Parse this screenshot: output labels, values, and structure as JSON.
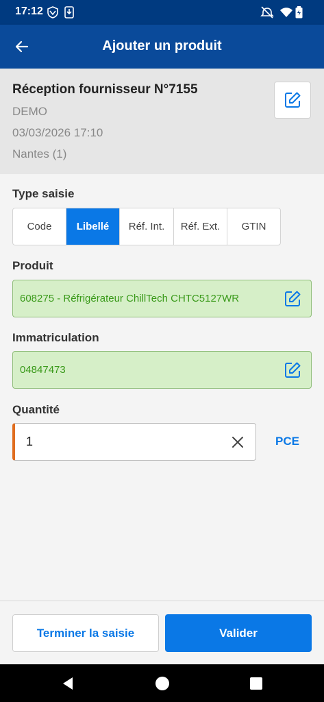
{
  "status_bar": {
    "time": "17:12"
  },
  "app_bar": {
    "title": "Ajouter un produit"
  },
  "document": {
    "title": "Réception fournisseur N°7155",
    "company": "DEMO",
    "datetime": "03/03/2026 17:10",
    "location": "Nantes (1)"
  },
  "type_saisie": {
    "label": "Type saisie",
    "options": [
      "Code",
      "Libellé",
      "Réf. Int.",
      "Réf. Ext.",
      "GTIN"
    ],
    "selected": "Libellé"
  },
  "produit": {
    "label": "Produit",
    "value": "608275 - Réfrigérateur ChillTech CHTC5127WR"
  },
  "immatriculation": {
    "label": "Immatriculation",
    "value": "04847473"
  },
  "quantite": {
    "label": "Quantité",
    "value": "1",
    "unit": "PCE"
  },
  "footer": {
    "finish_label": "Terminer la saisie",
    "validate_label": "Valider"
  },
  "colors": {
    "app_bar": "#0a4a9a",
    "status_bar": "#003a80",
    "accent": "#0a78e6",
    "field_valid_bg": "#d6efc8",
    "field_valid_text": "#3a9a1a",
    "required_marker": "#e06d1f"
  },
  "icons": {
    "back": "arrow-left-icon",
    "edit": "edit-pencil-icon",
    "clear": "close-icon"
  }
}
